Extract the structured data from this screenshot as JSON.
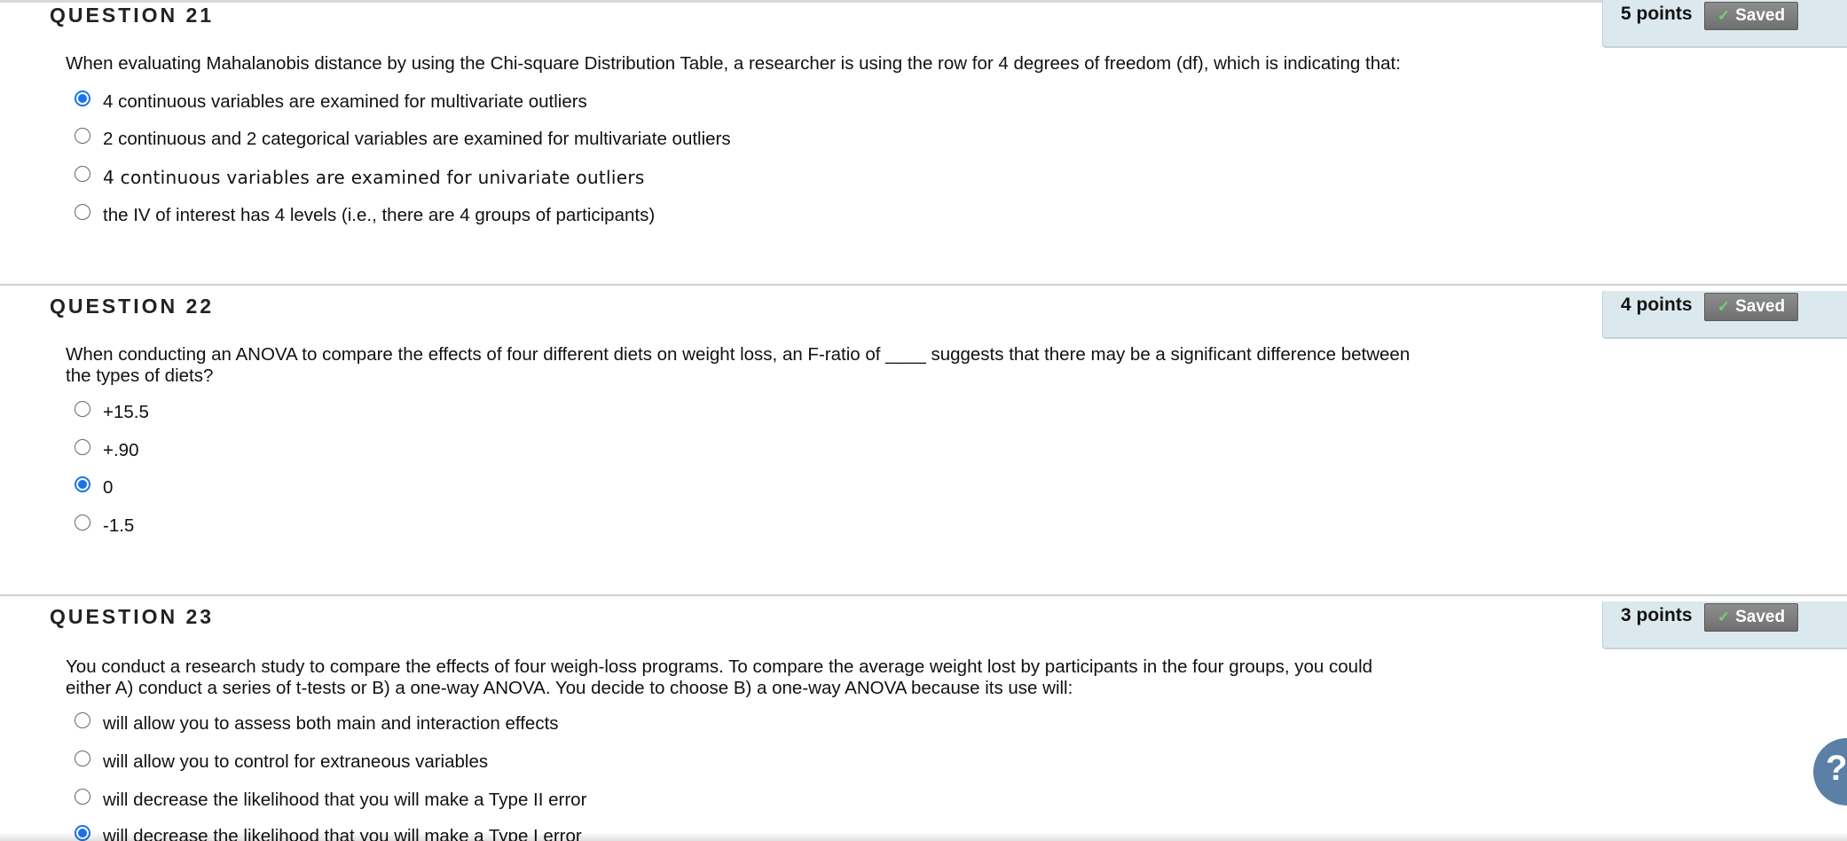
{
  "questions": [
    {
      "title": "QUESTION 21",
      "points": "5 points",
      "saved_label": "Saved",
      "text": "When evaluating Mahalanobis distance by using the Chi-square Distribution Table, a researcher is using the row for 4 degrees of freedom (df), which is indicating that:",
      "options": [
        {
          "label": "4 continuous variables are examined for multivariate outliers",
          "selected": true
        },
        {
          "label": "2 continuous and 2 categorical variables are examined for multivariate outliers",
          "selected": false
        },
        {
          "label": "4 continuous variables are examined for univariate outliers",
          "selected": false
        },
        {
          "label": "the IV of interest has 4 levels (i.e., there are 4 groups of participants)",
          "selected": false
        }
      ]
    },
    {
      "title": "QUESTION 22",
      "points": "4 points",
      "saved_label": "Saved",
      "text_line1": "When conducting an ANOVA to compare the effects of four different diets on weight loss, an F-ratio of ____ suggests that there may be a significant difference between",
      "text_line2": "the types of diets?",
      "options": [
        {
          "label": "+15.5",
          "selected": false
        },
        {
          "label": "+.90",
          "selected": false
        },
        {
          "label": "0",
          "selected": true
        },
        {
          "label": "-1.5",
          "selected": false
        }
      ]
    },
    {
      "title": "QUESTION 23",
      "points": "3 points",
      "saved_label": "Saved",
      "text_line1": "You conduct a research study to compare the effects of four weigh-loss programs.  To compare the average weight lost by participants in the four groups, you could",
      "text_line2": "either A) conduct a series of t-tests or B) a one-way ANOVA.  You decide to choose B) a one-way ANOVA because its use will:",
      "options": [
        {
          "label": "will allow you to assess both main and interaction effects",
          "selected": false
        },
        {
          "label": "will allow you to control for extraneous variables",
          "selected": false
        },
        {
          "label": "will decrease the likelihood that you will make a Type II error",
          "selected": false
        },
        {
          "label": "will decrease the likelihood that you will make a Type I error",
          "selected": true
        }
      ]
    }
  ],
  "help_button_glyph": "?",
  "icons": {
    "saved_check": "check-icon",
    "help": "question-mark-icon"
  },
  "colors": {
    "accent": "#1a73e8",
    "points_bg": "#dbe9ef",
    "saved_btn": "#7a7a7a",
    "help_btn": "#5c7fa6"
  }
}
